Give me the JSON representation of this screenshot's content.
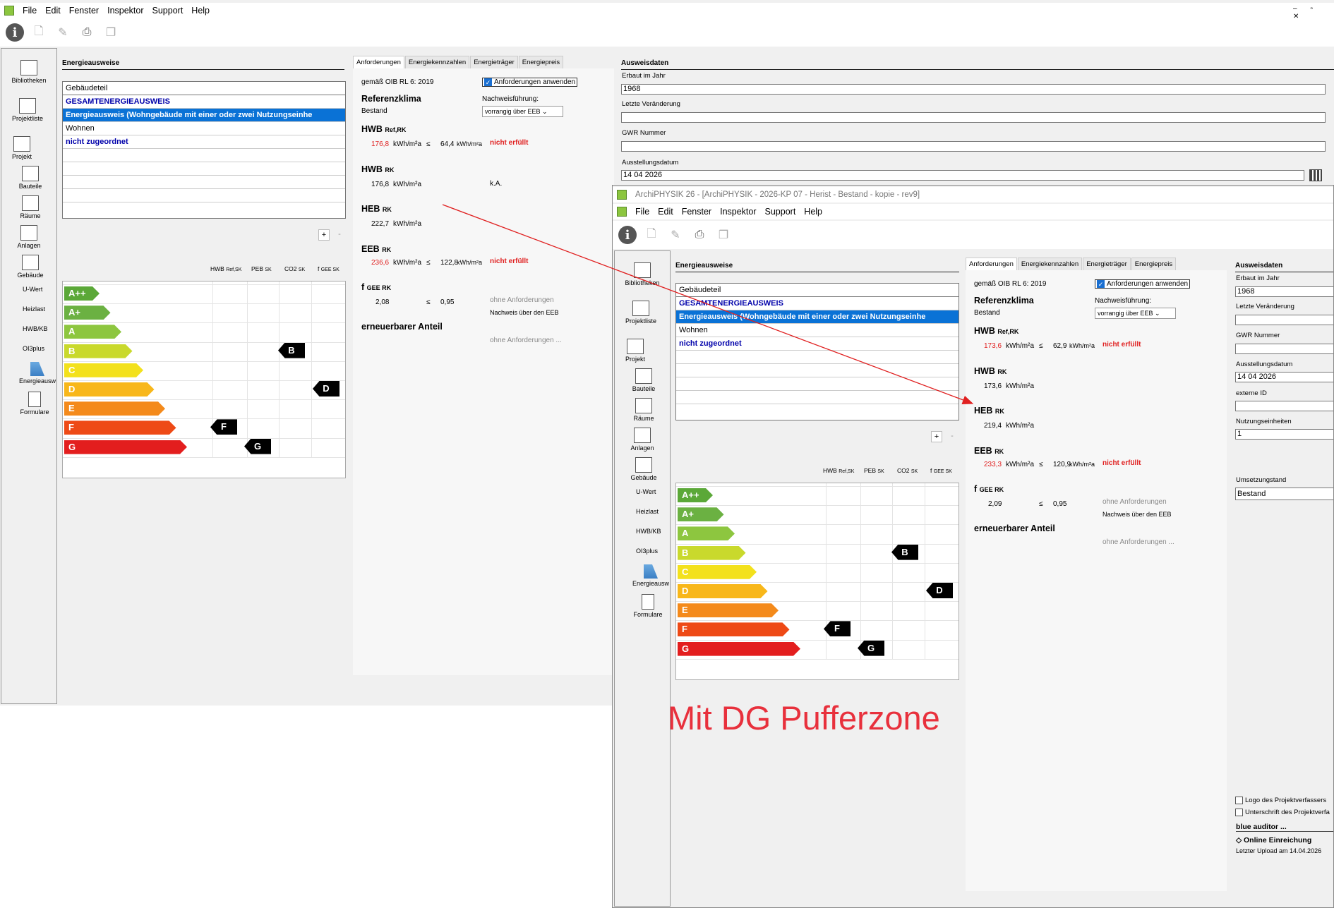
{
  "menu": [
    "File",
    "Edit",
    "Fenster",
    "Inspektor",
    "Support",
    "Help"
  ],
  "win2_title": "ArchiPHYSIK 26 - [ArchiPHYSIK - 2026-KP 07 - Herist - Bestand - kopie - rev9]",
  "sidebar": {
    "bibliotheken": "Bibliotheken",
    "projektliste": "Projektliste",
    "projekt": "Projekt",
    "bauteile": "Bauteile",
    "raeume": "Räume",
    "anlagen": "Anlagen",
    "gebaeude": "Gebäude",
    "uwert": "U-Wert",
    "heizlast": "Heizlast",
    "hwbkb": "HWB/KB",
    "oi3plus": "OI3plus",
    "energieausw": "Energieausw",
    "formulare": "Formulare"
  },
  "energieausweise": {
    "title": "Energieausweise",
    "header": "Gebäudeteil",
    "rows": [
      "GESAMTENERGIEAUSWEIS",
      "Energieausweis (Wohngebäude  mit einer oder zwei Nutzungseinhe",
      "Wohnen",
      "nicht zugeordnet"
    ],
    "plus": "+",
    "minus": "-"
  },
  "chart_header": {
    "hwb": "HWB",
    "hwb_sub": "Ref,SK",
    "peb": "PEB",
    "peb_sub": "SK",
    "co2": "CO2",
    "co2_sub": "SK",
    "fgee": "f",
    "fgee_sub": "GEE SK"
  },
  "classes": [
    {
      "label": "A++",
      "color": "#5ba838"
    },
    {
      "label": "A+",
      "color": "#6bb142"
    },
    {
      "label": "A",
      "color": "#8dc63f"
    },
    {
      "label": "B",
      "color": "#c9d92c"
    },
    {
      "label": "C",
      "color": "#f3e11c"
    },
    {
      "label": "D",
      "color": "#f8b71a"
    },
    {
      "label": "E",
      "color": "#f48a1b"
    },
    {
      "label": "F",
      "color": "#ee4a16"
    },
    {
      "label": "G",
      "color": "#e31e1e"
    }
  ],
  "markers": [
    {
      "label": "B",
      "column": "hwb_marker",
      "class_index": 3
    },
    {
      "label": "D",
      "column": "fgee",
      "class_index": 5
    },
    {
      "label": "F",
      "column": "peb",
      "class_index": 7
    },
    {
      "label": "G",
      "column": "co2",
      "class_index": 8
    }
  ],
  "tabs": [
    "Anforderungen",
    "Energiekennzahlen",
    "Energieträger",
    "Energiepreis"
  ],
  "req_common": {
    "oib": "gemäß OIB RL 6: 2019",
    "apply": "Anforderungen anwenden",
    "nachweis_label": "Nachweisführung:",
    "nachweis_value": "vorrangig über EEB",
    "ref_title": "Referenzklima",
    "bestand": "Bestand",
    "hwbref": "HWB",
    "hwbref_sub": "Ref,RK",
    "hwb": "HWB",
    "hwb_sub": "RK",
    "heb": "HEB",
    "heb_sub": "RK",
    "eeb": "EEB",
    "eeb_sub": "RK",
    "fgee": "f",
    "fgee_sub": "GEE RK",
    "unit": "kWh/m²a",
    "le": "≤",
    "nicht": "nicht erfüllt",
    "ohne": "ohne Anforderungen",
    "ohne2": "ohne Anforderungen ...",
    "nachweis_eeb": "Nachweis über den EEB",
    "ern": "erneuerbarer Anteil",
    "ka": "k.A."
  },
  "w1_values": {
    "hwbref": "176,8",
    "hwbref_req": "64,4",
    "hwb": "176,8",
    "heb": "222,7",
    "eeb": "236,6",
    "eeb_req": "122,8",
    "fgee": "2,08",
    "fgee_req": "0,95"
  },
  "w2_values": {
    "hwbref": "173,6",
    "hwbref_req": "62,9",
    "hwb": "173,6",
    "heb": "219,4",
    "eeb": "233,3",
    "eeb_req": "120,9",
    "fgee": "2,09",
    "fgee_req": "0,95"
  },
  "ausweisdaten": {
    "title": "Ausweisdaten",
    "erbaut_label": "Erbaut im Jahr",
    "erbaut": "1968",
    "letzte_label": "Letzte Veränderung",
    "gwr_label": "GWR Nummer",
    "datum_label": "Ausstellungsdatum",
    "datum": "14 04 2026",
    "extern_label": "externe ID",
    "nutz_label": "Nutzungseinheiten",
    "nutz": "1",
    "umsetz_label": "Umsetzungstand",
    "umsetz": "Bestand",
    "logo": "Logo des Projektverfassers",
    "unterschrift": "Unterschrift des Projektverfa",
    "blue": "blue auditor ...",
    "online": "Online Einreichung",
    "upload": "Letzter Upload am 14.04.2026"
  },
  "annotation": "Mit DG Pufferzone"
}
